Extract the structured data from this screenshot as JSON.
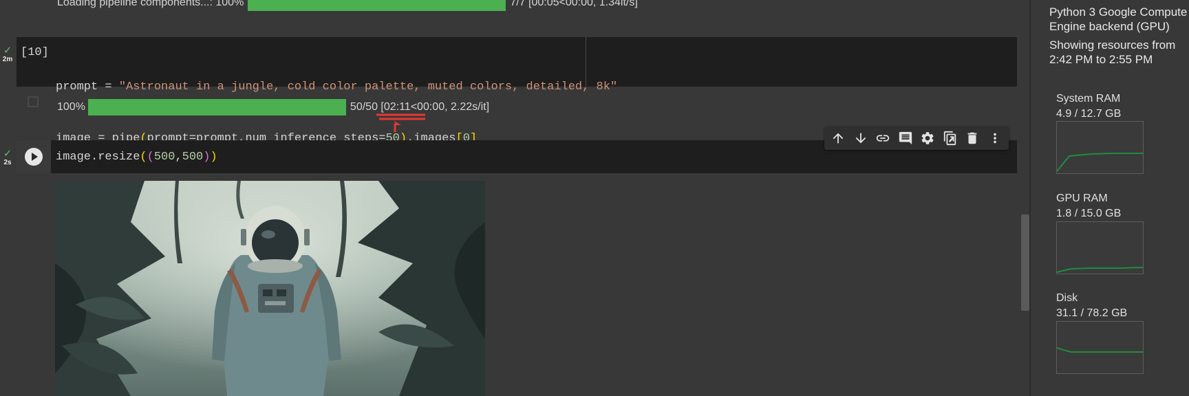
{
  "loading_line": {
    "label": "Loading pipeline components...: 100%",
    "progress": 1.0,
    "stats": "7/7 [00:05<00:00, 1.34it/s]"
  },
  "cell_10": {
    "status_icon": "check-icon",
    "exec_time": "2m",
    "prompt_number": "[10]",
    "line1_prefix": "prompt = ",
    "line1_string": "\"Astronaut in a jungle, cold color palette, muted colors, detailed, 8k\"",
    "line2_a": "image = pipe",
    "line2_b": "(",
    "line2_c": "prompt=prompt,num_inference_steps=",
    "line2_d": "50",
    "line2_e": ")",
    "line2_f": ".images",
    "line2_g": "[",
    "line2_h": "0",
    "line2_i": "]"
  },
  "cell_10_output": {
    "percent": "100%",
    "progress": 1.0,
    "stats": "50/50 [02:11<00:00, 2.22s/it]",
    "annotation_color": "#e53935"
  },
  "cell_11": {
    "status_icon": "check-icon",
    "exec_time": "2s",
    "code_a": "image.resize",
    "code_b": "(",
    "code_c": "(",
    "code_d": "500",
    "code_e": ",",
    "code_f": "500",
    "code_g": ")",
    "code_h": ")"
  },
  "toolbar": {
    "icons": [
      "arrow-up-icon",
      "arrow-down-icon",
      "link-icon",
      "comment-icon",
      "gear-icon",
      "mirror-cell-icon",
      "trash-icon",
      "more-vert-icon"
    ]
  },
  "resources": {
    "backend_line1": "Python 3 Google Compute",
    "backend_line2": "Engine backend (GPU)",
    "showing_line1": "Showing resources from",
    "showing_line2": "2:42 PM to 2:55 PM",
    "system_ram_label": "System RAM",
    "system_ram_value": "4.9 / 12.7 GB",
    "gpu_ram_label": "GPU RAM",
    "gpu_ram_value": "1.8 / 15.0 GB",
    "disk_label": "Disk",
    "disk_value": "31.1 / 78.2 GB",
    "graph_color": "#1e8e3e"
  }
}
